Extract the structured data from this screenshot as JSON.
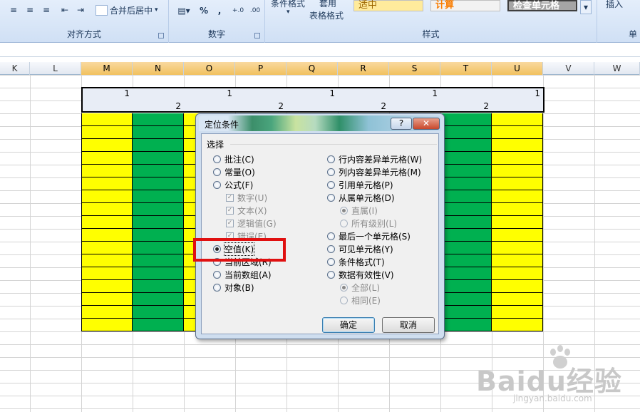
{
  "ribbon": {
    "align_group_label": "对齐方式",
    "merge_center": "合并后居中",
    "number_group_label": "数字",
    "percent": "%",
    "comma": ",",
    "cond_format": "条件格式",
    "table_format_1": "套用",
    "table_format_2": "表格格式",
    "style_neutral": "适中",
    "style_calc": "计算",
    "style_check": "检查单元格",
    "styles_group_label": "样式",
    "insert": "插入",
    "cells_group_label": "单"
  },
  "columns": [
    "K",
    "L",
    "M",
    "N",
    "O",
    "P",
    "Q",
    "R",
    "S",
    "T",
    "U",
    "V",
    "W"
  ],
  "row1_values": [
    "1",
    "1",
    "1",
    "1",
    "1"
  ],
  "row2_values": [
    "2",
    "2",
    "2",
    "2"
  ],
  "colors": {
    "yellow": "#ffff00",
    "green": "#00b050",
    "selected_header": "#f5c86a",
    "red_highlight": "#e01010"
  },
  "dialog": {
    "title": "定位条件",
    "help_btn": "?",
    "close_btn": "✕",
    "group_label": "选择",
    "left_options": [
      {
        "label": "批注(C)",
        "checked": false
      },
      {
        "label": "常量(O)",
        "checked": false
      },
      {
        "label": "公式(F)",
        "checked": false
      }
    ],
    "formula_subs": [
      "数字(U)",
      "文本(X)",
      "逻辑值(G)",
      "错误(E)"
    ],
    "left_options_2": [
      {
        "label": "空值(K)",
        "checked": true
      },
      {
        "label": "当前区域(R)",
        "checked": false
      },
      {
        "label": "当前数组(A)",
        "checked": false
      },
      {
        "label": "对象(B)",
        "checked": false
      }
    ],
    "right_options": [
      {
        "label": "行内容差异单元格(W)",
        "checked": false
      },
      {
        "label": "列内容差异单元格(M)",
        "checked": false
      },
      {
        "label": "引用单元格(P)",
        "checked": false
      },
      {
        "label": "从属单元格(D)",
        "checked": false
      }
    ],
    "dependent_subs": [
      {
        "label": "直属(I)",
        "checked": true
      },
      {
        "label": "所有级别(L)",
        "checked": false
      }
    ],
    "right_options_2": [
      {
        "label": "最后一个单元格(S)",
        "checked": false
      },
      {
        "label": "可见单元格(Y)",
        "checked": false
      },
      {
        "label": "条件格式(T)",
        "checked": false
      },
      {
        "label": "数据有效性(V)",
        "checked": false
      }
    ],
    "validation_subs": [
      {
        "label": "全部(L)",
        "checked": true
      },
      {
        "label": "相同(E)",
        "checked": false
      }
    ],
    "ok": "确定",
    "cancel": "取消"
  },
  "watermark": {
    "logo": "Baidu经验",
    "sub": "jingyan.baidu.com"
  }
}
